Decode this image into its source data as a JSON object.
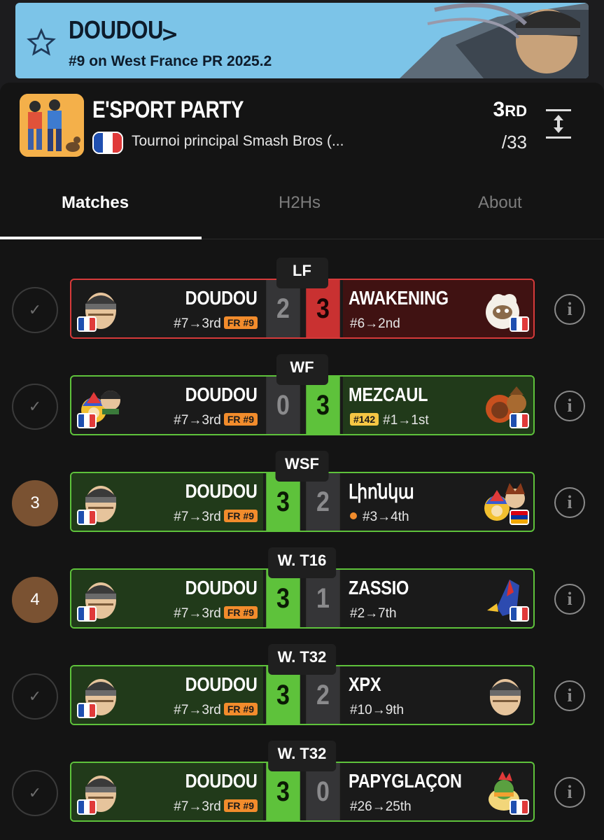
{
  "banner": {
    "player_name": "DOUDOU",
    "chevron": ">",
    "ranking_text": "#9 on West France PR 2025.2",
    "favorite_icon": "star-icon",
    "background_color": "#7cc4e8"
  },
  "tournament": {
    "name": "E'SPORT PARTY",
    "event": "Tournoi principal Smash Bros (...",
    "placement": "3",
    "placement_suffix": "RD",
    "entrants": "/33",
    "country_flag": "france-flag-icon",
    "expand_icon": "expand-vertical-icon"
  },
  "tabs": [
    {
      "label": "Matches",
      "active": true
    },
    {
      "label": "H2Hs",
      "active": false
    },
    {
      "label": "About",
      "active": false
    }
  ],
  "colors": {
    "win": "#5ec23b",
    "loss": "#c93131",
    "pr_badge": "#f28c2c",
    "seed_circle": "#7a5232"
  },
  "matches": [
    {
      "round": "LF",
      "status": "check-icon",
      "result": "loss",
      "left": {
        "name": "DOUDOU",
        "seed": "#7→3rd",
        "badge": "FR #9",
        "score": "2",
        "character": "snake-icon",
        "flag": "france"
      },
      "right": {
        "name": "AWAKENING",
        "seed": "#6→2nd",
        "score": "3",
        "character": "jigglypuff-icon",
        "flag": "france"
      }
    },
    {
      "round": "WF",
      "status": "check-icon",
      "result": "loss",
      "left": {
        "name": "DOUDOU",
        "seed": "#7→3rd",
        "badge": "FR #9",
        "score": "0",
        "character": "king-dedede-icon",
        "flag": "france"
      },
      "right": {
        "name": "MEZCAUL",
        "badge": "#142",
        "seed": "#1→1st",
        "score": "3",
        "character": "ganondorf-icon",
        "flag": "france"
      }
    },
    {
      "round": "WSF",
      "status": "3",
      "result": "win",
      "left": {
        "name": "DOUDOU",
        "seed": "#7→3rd",
        "badge": "FR #9",
        "score": "3",
        "character": "snake-icon",
        "flag": "france"
      },
      "right": {
        "name": "Լիոնկա",
        "seed": "#3→4th",
        "score": "2",
        "character": "king-dedede-icon",
        "flag": "armenia",
        "online_dot": true
      }
    },
    {
      "round": "W. T16",
      "status": "4",
      "result": "win",
      "left": {
        "name": "DOUDOU",
        "seed": "#7→3rd",
        "badge": "FR #9",
        "score": "3",
        "character": "snake-icon",
        "flag": "france"
      },
      "right": {
        "name": "ZASSIO",
        "seed": "#2→7th",
        "score": "1",
        "character": "falco-icon",
        "flag": "france"
      }
    },
    {
      "round": "W. T32",
      "status": "check-icon",
      "result": "win",
      "left": {
        "name": "DOUDOU",
        "seed": "#7→3rd",
        "badge": "FR #9",
        "score": "3",
        "character": "snake-icon",
        "flag": "france"
      },
      "right": {
        "name": "XPX",
        "seed": "#10→9th",
        "score": "2",
        "character": "snake-icon",
        "flag": "none"
      }
    },
    {
      "round": "W. T32",
      "status": "check-icon",
      "result": "win",
      "left": {
        "name": "DOUDOU",
        "seed": "#7→3rd",
        "badge": "FR #9",
        "score": "3",
        "character": "snake-icon",
        "flag": "france"
      },
      "right": {
        "name": "PAPYGLAÇON",
        "seed": "#26→25th",
        "score": "0",
        "character": "bowser-icon",
        "flag": "france"
      }
    }
  ]
}
